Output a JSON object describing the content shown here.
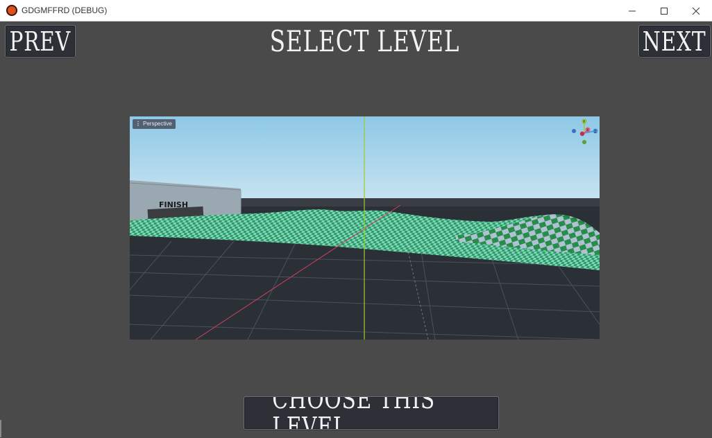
{
  "window": {
    "title": "GDGMFFRD (DEBUG)",
    "controls": {
      "minimize": "minimize-icon",
      "maximize": "maximize-icon",
      "close": "close-icon"
    }
  },
  "menu": {
    "heading": "SELECT LEVEL",
    "prev_label": "PREV",
    "next_label": "NEXT",
    "choose_label": "CHOOSE THIS LEVEL"
  },
  "preview": {
    "view_mode": "Perspective",
    "sign_text": "FINISH",
    "gizmo_axes": [
      "Y",
      "X",
      "Z"
    ]
  },
  "colors": {
    "background": "#4a4a4a",
    "button_bg": "#2e3038",
    "sky_top": "#8ec8e6",
    "terrain": "#3aa56a",
    "axis_y": "#9ccc2a",
    "axis_x": "#d04060"
  }
}
